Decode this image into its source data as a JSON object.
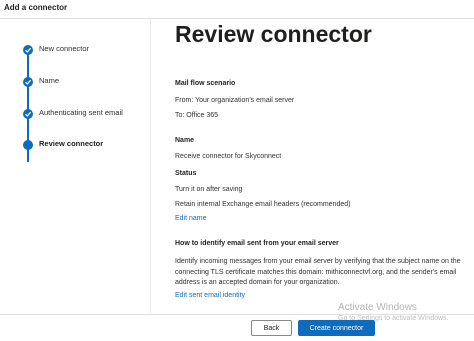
{
  "panel": {
    "title": "Add a connector"
  },
  "steps": [
    {
      "label": "New connector"
    },
    {
      "label": "Name"
    },
    {
      "label": "Authenticating sent email"
    },
    {
      "label": "Review connector"
    }
  ],
  "main": {
    "heading": "Review connector",
    "mail_flow": {
      "title": "Mail flow scenario",
      "from": "From: Your organization's email server",
      "to": "To: Office 365"
    },
    "name": {
      "title": "Name",
      "value": "Receive connector for Skyconnect"
    },
    "status": {
      "title": "Status",
      "line1": "Turn it on after saving",
      "line2": "Retain internal Exchange email headers (recommended)"
    },
    "edit_name_link": "Edit name",
    "identify": {
      "title": "How to identify email sent from your email server",
      "body": "Identify incoming messages from your email server by verifying that the subject name on the connecting TLS certificate matches this domain: mithiconnectvf.org, and the sender's email address is an accepted domain for your organization.",
      "edit_link": "Edit sent email identity"
    }
  },
  "footer": {
    "back_label": "Back",
    "create_label": "Create connector"
  },
  "watermark": {
    "title": "Activate Windows",
    "subtitle": "Go to Settings to activate Windows."
  },
  "colors": {
    "accent": "#0f6cbd",
    "text": "#201f1e",
    "border": "#e1dfdd"
  }
}
